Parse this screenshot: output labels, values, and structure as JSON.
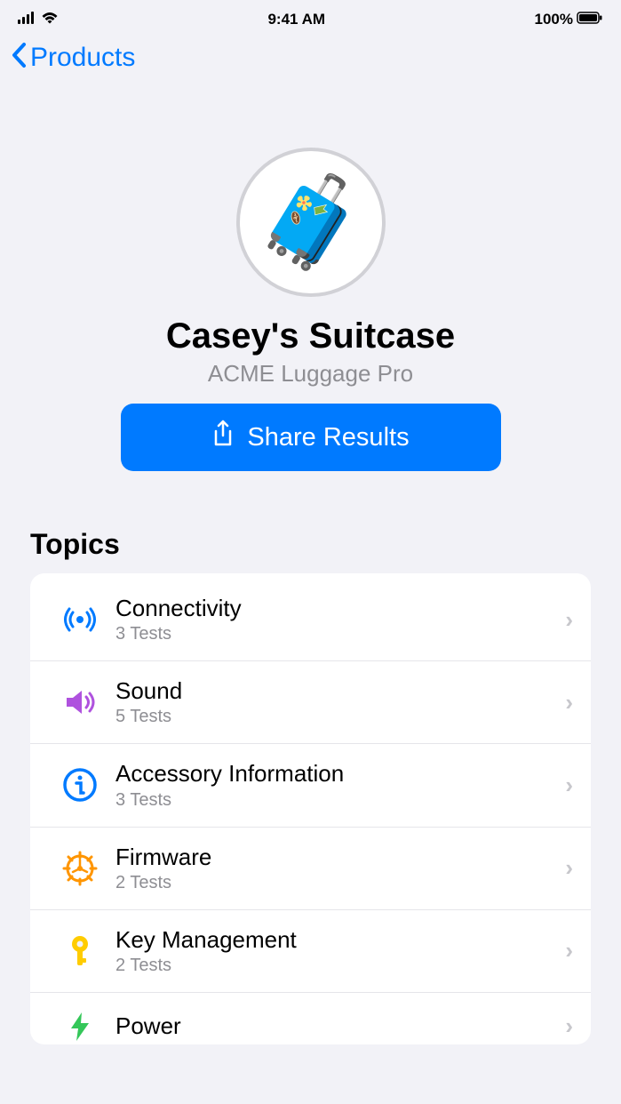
{
  "statusBar": {
    "time": "9:41 AM",
    "battery": "100%"
  },
  "nav": {
    "backLabel": "Products"
  },
  "header": {
    "deviceName": "Casey's Suitcase",
    "deviceModel": "ACME Luggage Pro",
    "shareLabel": "Share Results",
    "avatarEmoji": "🧳"
  },
  "topics": {
    "sectionTitle": "Topics",
    "items": [
      {
        "title": "Connectivity",
        "subtitle": "3 Tests",
        "iconName": "signal-icon",
        "iconColor": "#007aff"
      },
      {
        "title": "Sound",
        "subtitle": "5 Tests",
        "iconName": "speaker-icon",
        "iconColor": "#af52de"
      },
      {
        "title": "Accessory Information",
        "subtitle": "3 Tests",
        "iconName": "info-icon",
        "iconColor": "#007aff"
      },
      {
        "title": "Firmware",
        "subtitle": "2 Tests",
        "iconName": "gear-icon",
        "iconColor": "#ff9500"
      },
      {
        "title": "Key Management",
        "subtitle": "2 Tests",
        "iconName": "key-icon",
        "iconColor": "#ffcc00"
      },
      {
        "title": "Power",
        "subtitle": "",
        "iconName": "power-icon",
        "iconColor": "#34c759"
      }
    ]
  }
}
